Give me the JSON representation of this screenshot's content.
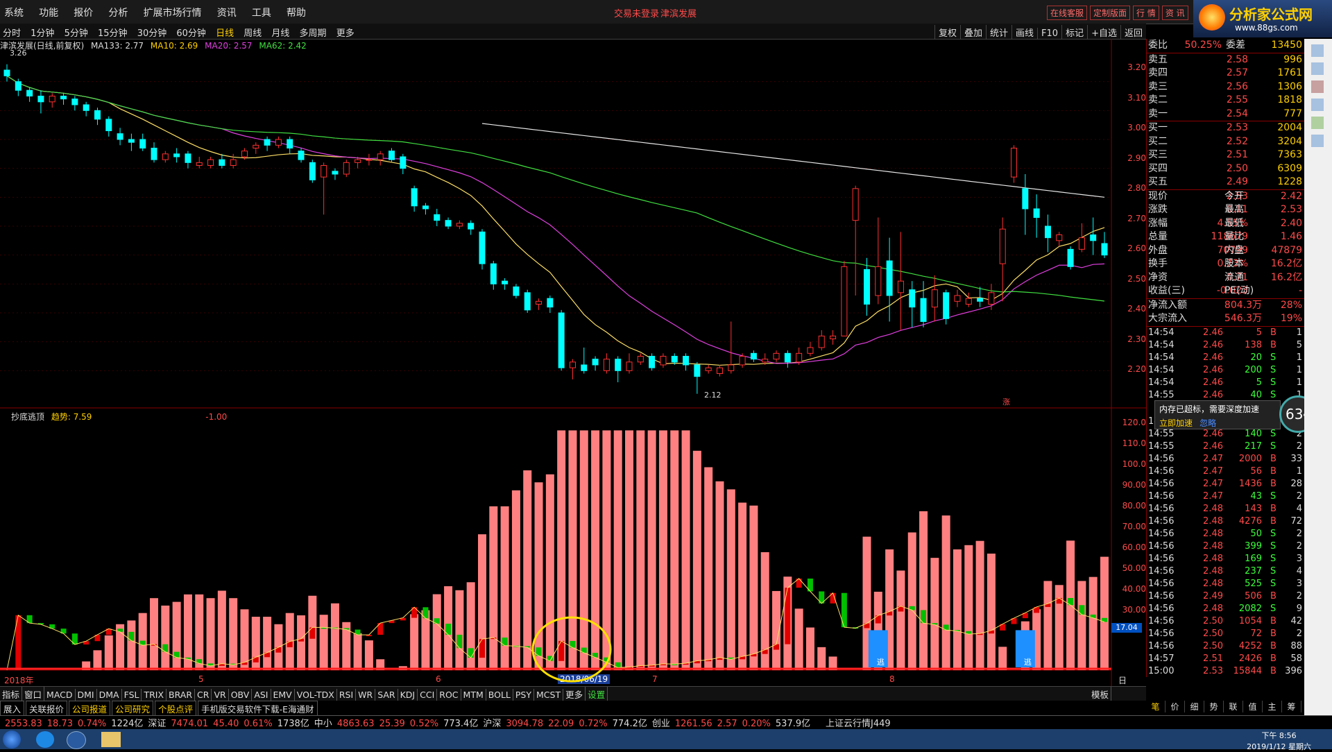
{
  "menu": [
    "系统",
    "功能",
    "报价",
    "分析",
    "扩展市场行情",
    "资讯",
    "工具",
    "帮助"
  ],
  "title": {
    "login": "交易未登录",
    "stock": "津滨发展"
  },
  "top_buttons": [
    "在线客服",
    "定制版面",
    "行 情",
    "资 讯"
  ],
  "brand": {
    "name": "分析家公式网",
    "url": "www.88gs.com"
  },
  "periods": [
    "分时",
    "1分钟",
    "5分钟",
    "15分钟",
    "30分钟",
    "60分钟",
    "日线",
    "周线",
    "月线",
    "多周期",
    "更多"
  ],
  "period_selected": "日线",
  "right_tools": [
    "复权",
    "叠加",
    "统计",
    "画线",
    "F10",
    "标记",
    "+自选",
    "返回"
  ],
  "ma_legend": {
    "name": "津滨发展(日线,前复权)",
    "ma133": "MA133: 2.77",
    "ma10": "MA10: 2.69",
    "ma20": "MA20: 2.57",
    "ma62": "MA62: 2.42"
  },
  "price_labels": {
    "high": "3.26",
    "low": "2.12",
    "zhang": "涨"
  },
  "price_axis": [
    "3.20",
    "3.10",
    "3.00",
    "2.90",
    "2.80",
    "2.70",
    "2.60",
    "2.50",
    "2.40",
    "2.30",
    "2.20"
  ],
  "ind_legend": {
    "name": "抄底逃顶",
    "trend": "趋势: 7.59",
    "val": "-1.00"
  },
  "ind_axis": [
    "120.0",
    "110.0",
    "100.0",
    "90.00",
    "80.00",
    "70.00",
    "60.00",
    "50.00",
    "40.00",
    "30.00"
  ],
  "ind_marker": "17.04",
  "date_axis": {
    "year": "2018年",
    "m5": "5",
    "m6": "6",
    "m7": "7",
    "m8": "8",
    "cursor": "2018/06/19",
    "period": "日线"
  },
  "tabs": [
    "指标",
    "窗口",
    "MACD",
    "DMI",
    "DMA",
    "FSL",
    "TRIX",
    "BRAR",
    "CR",
    "VR",
    "OBV",
    "ASI",
    "EMV",
    "VOL-TDX",
    "RSI",
    "WR",
    "SAR",
    "KDJ",
    "CCI",
    "ROC",
    "MTM",
    "BOLL",
    "PSY",
    "MCST",
    "更多",
    "设置"
  ],
  "tab_right": "模板",
  "links": [
    "展入",
    "关联报价",
    "公司报道",
    "公司研究",
    "个股点评",
    "手机版交易软件下载-E海通财"
  ],
  "quote": {
    "weibi": {
      "label": "委比",
      "value": "50.25%",
      "label2": "委差",
      "n": "13450"
    },
    "sell": [
      [
        "卖五",
        "2.58",
        "996"
      ],
      [
        "卖四",
        "2.57",
        "1761"
      ],
      [
        "卖三",
        "2.56",
        "1306"
      ],
      [
        "卖二",
        "2.55",
        "1818"
      ],
      [
        "卖一",
        "2.54",
        "777"
      ]
    ],
    "buy": [
      [
        "买一",
        "2.53",
        "2004"
      ],
      [
        "买二",
        "2.52",
        "3204"
      ],
      [
        "买三",
        "2.51",
        "7363"
      ],
      [
        "买四",
        "2.50",
        "6309"
      ],
      [
        "买五",
        "2.49",
        "1228"
      ]
    ],
    "info": [
      [
        "现价",
        "2.53",
        "今开",
        "2.42"
      ],
      [
        "涨跌",
        "0.11",
        "最高",
        "2.53"
      ],
      [
        "涨幅",
        "4.55%",
        "最低",
        "2.40"
      ],
      [
        "总量",
        "118679",
        "量比",
        "1.46"
      ],
      [
        "外盘",
        "70799",
        "内盘",
        "47879"
      ],
      [
        "换手",
        "0.73%",
        "股本",
        "16.2亿"
      ],
      [
        "净资",
        "0.71",
        "流通",
        "16.2亿"
      ],
      [
        "收益(三)",
        "-0.023",
        "PE(动)",
        "-"
      ]
    ],
    "flow": [
      [
        "净流入额",
        "804.3万",
        "28%"
      ],
      [
        "大宗流入",
        "546.3万",
        "19%"
      ]
    ]
  },
  "ticks": [
    [
      "14:54",
      "2.46",
      "5",
      "B",
      "1"
    ],
    [
      "14:54",
      "2.46",
      "138",
      "B",
      "5"
    ],
    [
      "14:54",
      "2.46",
      "20",
      "S",
      "1"
    ],
    [
      "14:54",
      "2.46",
      "200",
      "S",
      "1"
    ],
    [
      "14:54",
      "2.46",
      "5",
      "S",
      "1"
    ],
    [
      "14:55",
      "2.46",
      "40",
      "S",
      "1"
    ],
    [
      "14:55",
      "2.46",
      "40",
      "S",
      "1"
    ],
    [
      "14:55",
      "2.46",
      "140",
      "S",
      "2"
    ],
    [
      "14:55",
      "2.46",
      "217",
      "S",
      "2"
    ],
    [
      "14:56",
      "2.47",
      "2000",
      "B",
      "33"
    ],
    [
      "14:56",
      "2.47",
      "56",
      "B",
      "1"
    ],
    [
      "14:56",
      "2.47",
      "1436",
      "B",
      "28"
    ],
    [
      "14:56",
      "2.47",
      "43",
      "S",
      "2"
    ],
    [
      "14:56",
      "2.48",
      "143",
      "B",
      "4"
    ],
    [
      "14:56",
      "2.48",
      "4276",
      "B",
      "72"
    ],
    [
      "14:56",
      "2.48",
      "50",
      "S",
      "2"
    ],
    [
      "14:56",
      "2.48",
      "399",
      "S",
      "2"
    ],
    [
      "14:56",
      "2.48",
      "169",
      "S",
      "3"
    ],
    [
      "14:56",
      "2.48",
      "237",
      "S",
      "4"
    ],
    [
      "14:56",
      "2.48",
      "525",
      "S",
      "3"
    ],
    [
      "14:56",
      "2.49",
      "506",
      "B",
      "2"
    ],
    [
      "14:56",
      "2.48",
      "2082",
      "S",
      "9"
    ],
    [
      "14:56",
      "2.50",
      "1054",
      "B",
      "42"
    ],
    [
      "14:56",
      "2.50",
      "72",
      "B",
      "2"
    ],
    [
      "14:56",
      "2.50",
      "4252",
      "B",
      "88"
    ],
    [
      "14:57",
      "2.51",
      "2426",
      "B",
      "58"
    ],
    [
      "15:00",
      "2.53",
      "15844",
      "B",
      "396"
    ]
  ],
  "popup": {
    "text": "内存已超标，需要深度加速",
    "action": "立即加速",
    "ignore": "忽略",
    "pct": "63"
  },
  "bottom_tabs": [
    "笔",
    "价",
    "细",
    "势",
    "联",
    "值",
    "主",
    "筹"
  ],
  "statusbar": [
    {
      "t": "2553.83",
      "c": "#ff4a4a"
    },
    {
      "t": "18.73",
      "c": "#ff4a4a"
    },
    {
      "t": "0.74%",
      "c": "#ff4a4a"
    },
    {
      "t": "1224亿",
      "c": "#ddd"
    },
    {
      "t": "深证",
      "c": "#ddd"
    },
    {
      "t": "7474.01",
      "c": "#ff4a4a"
    },
    {
      "t": "45.40",
      "c": "#ff4a4a"
    },
    {
      "t": "0.61%",
      "c": "#ff4a4a"
    },
    {
      "t": "1738亿",
      "c": "#ddd"
    },
    {
      "t": "中小",
      "c": "#ddd"
    },
    {
      "t": "4863.63",
      "c": "#ff4a4a"
    },
    {
      "t": "25.39",
      "c": "#ff4a4a"
    },
    {
      "t": "0.52%",
      "c": "#ff4a4a"
    },
    {
      "t": "773.4亿",
      "c": "#ddd"
    },
    {
      "t": "沪深",
      "c": "#ddd"
    },
    {
      "t": "3094.78",
      "c": "#ff4a4a"
    },
    {
      "t": "22.09",
      "c": "#ff4a4a"
    },
    {
      "t": "0.72%",
      "c": "#ff4a4a"
    },
    {
      "t": "774.2亿",
      "c": "#ddd"
    },
    {
      "t": "创业",
      "c": "#ddd"
    },
    {
      "t": "1261.56",
      "c": "#ff4a4a"
    },
    {
      "t": "2.57",
      "c": "#ff4a4a"
    },
    {
      "t": "0.20%",
      "c": "#ff4a4a"
    },
    {
      "t": "537.9亿",
      "c": "#ddd"
    }
  ],
  "status_right": "上证云行情J449",
  "clock": {
    "time": "下午 8:56",
    "date": "2019/1/12 星期六"
  },
  "escape_label": "逃",
  "chart_data": {
    "type": "candlestick",
    "ylim": [
      2.1,
      3.3
    ],
    "candles": [
      [
        3.24,
        3.22,
        3.26,
        3.2
      ],
      [
        3.2,
        3.17,
        3.21,
        3.15
      ],
      [
        3.17,
        3.15,
        3.18,
        3.13
      ],
      [
        3.15,
        3.13,
        3.17,
        3.09
      ],
      [
        3.13,
        3.15,
        3.16,
        3.11
      ],
      [
        3.15,
        3.14,
        3.16,
        3.12
      ],
      [
        3.14,
        3.12,
        3.15,
        3.1
      ],
      [
        3.12,
        3.1,
        3.13,
        3.08
      ],
      [
        3.1,
        3.07,
        3.11,
        3.05
      ],
      [
        3.07,
        3.03,
        3.08,
        3.01
      ],
      [
        3.02,
        3.0,
        3.04,
        2.98
      ],
      [
        3.0,
        2.99,
        3.02,
        2.96
      ],
      [
        3.0,
        2.97,
        3.02,
        2.96
      ],
      [
        2.97,
        2.93,
        2.99,
        2.92
      ],
      [
        2.93,
        2.95,
        2.96,
        2.92
      ],
      [
        2.95,
        2.94,
        2.97,
        2.92
      ],
      [
        2.95,
        2.92,
        2.96,
        2.9
      ],
      [
        2.91,
        2.92,
        2.94,
        2.9
      ],
      [
        2.91,
        2.93,
        2.94,
        2.9
      ],
      [
        2.93,
        2.91,
        2.95,
        2.9
      ],
      [
        2.91,
        2.93,
        2.95,
        2.9
      ],
      [
        2.94,
        2.96,
        2.97,
        2.93
      ],
      [
        2.97,
        2.98,
        2.99,
        2.95
      ],
      [
        3.0,
        2.98,
        3.01,
        2.96
      ],
      [
        2.98,
        3.0,
        3.01,
        2.97
      ],
      [
        3.0,
        2.97,
        3.01,
        2.95
      ],
      [
        2.96,
        2.93,
        2.97,
        2.92
      ],
      [
        2.92,
        2.86,
        2.93,
        2.85
      ],
      [
        2.87,
        2.91,
        2.92,
        2.74
      ],
      [
        2.89,
        2.88,
        2.9,
        2.86
      ],
      [
        2.88,
        2.92,
        2.93,
        2.87
      ],
      [
        2.92,
        2.93,
        2.94,
        2.9
      ],
      [
        2.93,
        2.93,
        2.95,
        2.91
      ],
      [
        2.93,
        2.95,
        2.96,
        2.91
      ],
      [
        2.96,
        2.93,
        2.97,
        2.92
      ],
      [
        2.94,
        2.9,
        2.95,
        2.88
      ],
      [
        2.83,
        2.77,
        2.84,
        2.75
      ],
      [
        2.77,
        2.76,
        2.78,
        2.74
      ],
      [
        2.74,
        2.72,
        2.76,
        2.7
      ],
      [
        2.72,
        2.7,
        2.73,
        2.69
      ],
      [
        2.7,
        2.71,
        2.72,
        2.69
      ],
      [
        2.71,
        2.69,
        2.72,
        2.67
      ],
      [
        2.68,
        2.57,
        2.69,
        2.55
      ],
      [
        2.57,
        2.5,
        2.58,
        2.48
      ],
      [
        2.51,
        2.5,
        2.52,
        2.48
      ],
      [
        2.49,
        2.46,
        2.5,
        2.45
      ],
      [
        2.47,
        2.41,
        2.48,
        2.4
      ],
      [
        2.43,
        2.44,
        2.45,
        2.41
      ],
      [
        2.45,
        2.42,
        2.46,
        2.4
      ],
      [
        2.4,
        2.21,
        2.41,
        2.2
      ],
      [
        2.21,
        2.23,
        2.24,
        2.17
      ],
      [
        2.22,
        2.2,
        2.28,
        2.19
      ],
      [
        2.24,
        2.22,
        2.25,
        2.2
      ],
      [
        2.2,
        2.24,
        2.26,
        2.19
      ],
      [
        2.24,
        2.2,
        2.25,
        2.16
      ],
      [
        2.2,
        2.23,
        2.26,
        2.19
      ],
      [
        2.23,
        2.25,
        2.26,
        2.22
      ],
      [
        2.25,
        2.21,
        2.26,
        2.2
      ],
      [
        2.22,
        2.25,
        2.26,
        2.21
      ],
      [
        2.25,
        2.23,
        2.26,
        2.22
      ],
      [
        2.25,
        2.22,
        2.26,
        2.2
      ],
      [
        2.22,
        2.18,
        2.23,
        2.12
      ],
      [
        2.2,
        2.21,
        2.22,
        2.19
      ],
      [
        2.19,
        2.21,
        2.22,
        2.18
      ],
      [
        2.2,
        2.22,
        2.37,
        2.19
      ],
      [
        2.22,
        2.25,
        2.26,
        2.21
      ],
      [
        2.26,
        2.24,
        2.27,
        2.23
      ],
      [
        2.23,
        2.24,
        2.26,
        2.22
      ],
      [
        2.24,
        2.26,
        2.27,
        2.23
      ],
      [
        2.26,
        2.23,
        2.27,
        2.21
      ],
      [
        2.23,
        2.26,
        2.28,
        2.22
      ],
      [
        2.26,
        2.28,
        2.3,
        2.25
      ],
      [
        2.28,
        2.32,
        2.34,
        2.27
      ],
      [
        2.31,
        2.32,
        2.34,
        2.29
      ],
      [
        2.32,
        2.56,
        2.58,
        2.36
      ],
      [
        2.72,
        2.83,
        2.84,
        2.46
      ],
      [
        2.55,
        2.43,
        2.59,
        2.39
      ],
      [
        2.46,
        2.56,
        2.73,
        2.43
      ],
      [
        2.58,
        2.46,
        2.66,
        2.37
      ],
      [
        2.47,
        2.51,
        2.68,
        2.34
      ],
      [
        2.48,
        2.42,
        2.51,
        2.35
      ],
      [
        2.45,
        2.37,
        2.51,
        2.35
      ],
      [
        2.42,
        2.48,
        2.53,
        2.37
      ],
      [
        2.47,
        2.38,
        2.48,
        2.36
      ],
      [
        2.44,
        2.46,
        2.48,
        2.42
      ],
      [
        2.43,
        2.45,
        2.47,
        2.42
      ],
      [
        2.45,
        2.44,
        2.49,
        2.42
      ],
      [
        2.43,
        2.47,
        2.5,
        2.41
      ],
      [
        2.57,
        2.69,
        2.73,
        2.44
      ],
      [
        2.87,
        2.97,
        2.98,
        2.85
      ],
      [
        2.83,
        2.76,
        2.88,
        2.67
      ],
      [
        2.76,
        2.73,
        2.81,
        2.66
      ],
      [
        2.7,
        2.66,
        2.74,
        2.61
      ],
      [
        2.65,
        2.67,
        2.68,
        2.63
      ],
      [
        2.62,
        2.56,
        2.63,
        2.55
      ],
      [
        2.62,
        2.66,
        2.71,
        2.61
      ],
      [
        2.67,
        2.65,
        2.73,
        2.6
      ],
      [
        2.64,
        2.6,
        2.68,
        2.59
      ]
    ]
  }
}
